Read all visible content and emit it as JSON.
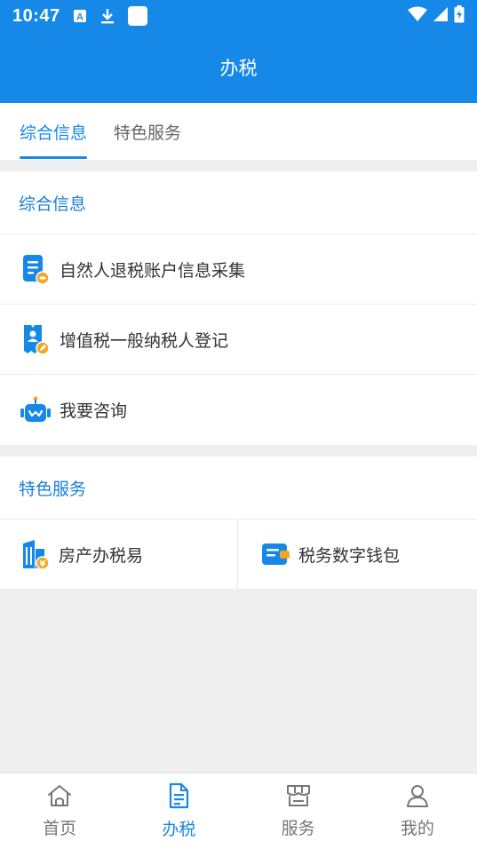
{
  "status_bar": {
    "time": "10:47",
    "icons": [
      "font-a-icon",
      "download-icon",
      "app-square-icon",
      "wifi-icon",
      "signal-icon",
      "battery-charging-icon"
    ]
  },
  "header": {
    "title": "办税"
  },
  "tabs": [
    {
      "label": "综合信息",
      "active": true
    },
    {
      "label": "特色服务",
      "active": false
    }
  ],
  "sections": {
    "info": {
      "title": "综合信息",
      "items": [
        {
          "label": "自然人退税账户信息采集",
          "icon": "document-coin-icon"
        },
        {
          "label": "增值税一般纳税人登记",
          "icon": "badge-edit-icon"
        },
        {
          "label": "我要咨询",
          "icon": "robot-icon"
        }
      ]
    },
    "special": {
      "title": "特色服务",
      "items": [
        {
          "label": "房产办税易",
          "icon": "building-coin-icon"
        },
        {
          "label": "税务数字钱包",
          "icon": "wallet-icon"
        }
      ]
    }
  },
  "bottom_nav": [
    {
      "label": "首页",
      "icon": "home-icon",
      "active": false
    },
    {
      "label": "办税",
      "icon": "document-icon",
      "active": true
    },
    {
      "label": "服务",
      "icon": "store-icon",
      "active": false
    },
    {
      "label": "我的",
      "icon": "person-icon",
      "active": false
    }
  ],
  "colors": {
    "primary": "#1688e8",
    "section_title": "#1a7fd6",
    "background": "#efefef",
    "accent_orange": "#f5a623"
  }
}
